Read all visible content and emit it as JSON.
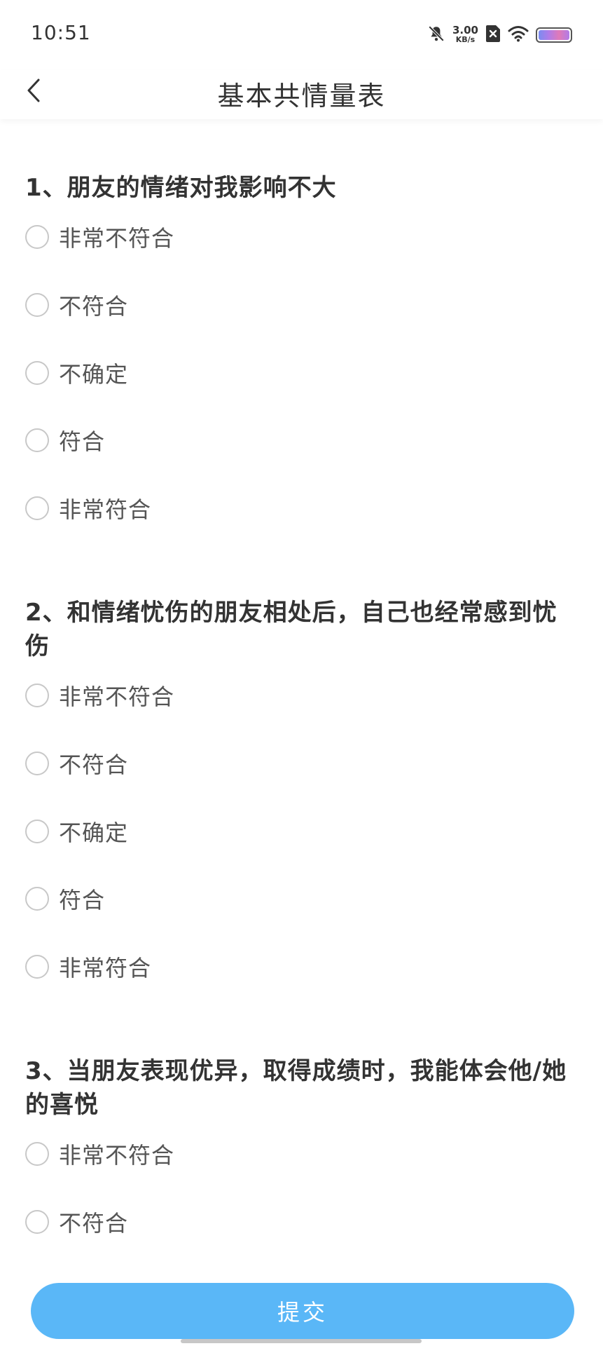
{
  "status_bar": {
    "time": "10:51",
    "net_speed_value": "3.00",
    "net_speed_unit": "KB/s",
    "icons": [
      "bell-muted-icon",
      "sim-x-icon",
      "wifi-icon",
      "battery-icon"
    ]
  },
  "header": {
    "title": "基本共情量表",
    "back_icon": "chevron-left-icon"
  },
  "questions": [
    {
      "title": "1、朋友的情绪对我影响不大",
      "options": [
        "非常不符合",
        "不符合",
        "不确定",
        "符合",
        "非常符合"
      ]
    },
    {
      "title_line1": "2、和情绪忧伤的朋友相处后，自己也经常感到忧",
      "title_line2": "伤",
      "options": [
        "非常不符合",
        "不符合",
        "不确定",
        "符合",
        "非常符合"
      ]
    },
    {
      "title_line1": "3、当朋友表现优异，取得成绩时，我能体会他/她",
      "title_line2": "的喜悦",
      "options": [
        "非常不符合",
        "不符合"
      ]
    }
  ],
  "submit_label": "提交",
  "colors": {
    "accent": "#5ab7f7",
    "text_primary": "#333333",
    "radio_border": "#c8c8c8"
  }
}
